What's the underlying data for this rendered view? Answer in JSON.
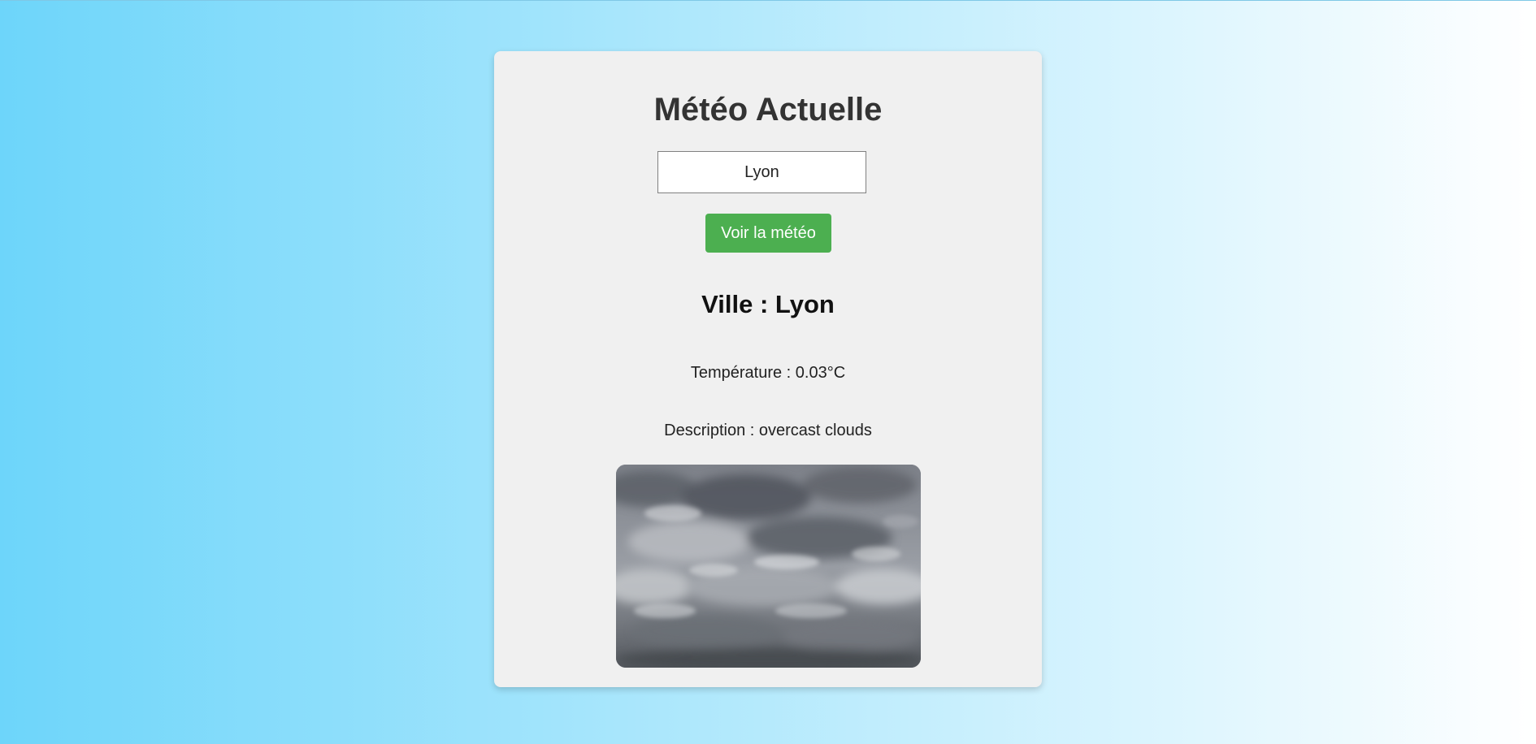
{
  "page": {
    "title": "Météo Actuelle"
  },
  "search": {
    "value": "Lyon",
    "button_label": "Voir la météo"
  },
  "result": {
    "city_prefix": "Ville : ",
    "city": "Lyon",
    "temperature_prefix": "Température : ",
    "temperature": "0.03°C",
    "description_prefix": "Description : ",
    "description": "overcast clouds",
    "image_icon": "overcast-clouds-photo"
  },
  "colors": {
    "background_start": "#6dd5fa",
    "background_end": "#ffffff",
    "card": "#f0f0f0",
    "button": "#4caf50",
    "title": "#333333"
  }
}
